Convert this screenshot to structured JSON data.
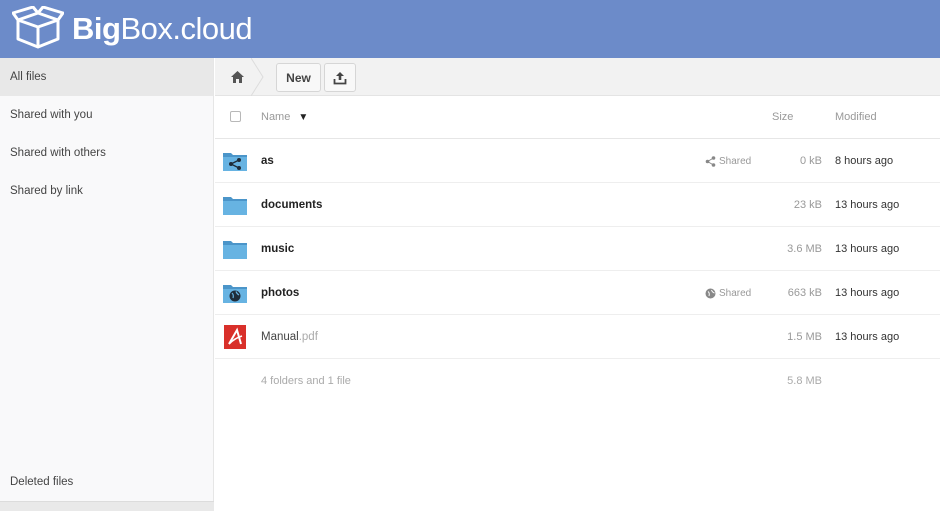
{
  "brand": {
    "bold": "Big",
    "rest": "Box.cloud"
  },
  "sidebar": {
    "items": [
      {
        "label": "All files"
      },
      {
        "label": "Shared with you"
      },
      {
        "label": "Shared with others"
      },
      {
        "label": "Shared by link"
      }
    ],
    "deleted": "Deleted files"
  },
  "controls": {
    "new_label": "New",
    "home_icon": "home-icon",
    "upload_icon": "upload-icon"
  },
  "table": {
    "headers": {
      "name": "Name",
      "size": "Size",
      "modified": "Modified"
    },
    "rows": [
      {
        "name": "as",
        "ext": "",
        "shared": "Shared",
        "size": "0 kB",
        "modified": "8 hours ago",
        "icon": "shared-folder-icon"
      },
      {
        "name": "documents",
        "ext": "",
        "shared": "",
        "size": "23 kB",
        "modified": "13 hours ago",
        "icon": "folder-icon"
      },
      {
        "name": "music",
        "ext": "",
        "shared": "",
        "size": "3.6 MB",
        "modified": "13 hours ago",
        "icon": "folder-icon"
      },
      {
        "name": "photos",
        "ext": "",
        "shared": "Shared",
        "size": "663 kB",
        "modified": "13 hours ago",
        "icon": "public-folder-icon"
      },
      {
        "name": "Manual",
        "ext": ".pdf",
        "shared": "",
        "size": "1.5 MB",
        "modified": "13 hours ago",
        "icon": "pdf-icon"
      }
    ],
    "summary": {
      "text": "4 folders and 1 file",
      "size": "5.8 MB"
    }
  },
  "colors": {
    "header": "#6c8bc9",
    "folder": "#5ba7d9"
  }
}
